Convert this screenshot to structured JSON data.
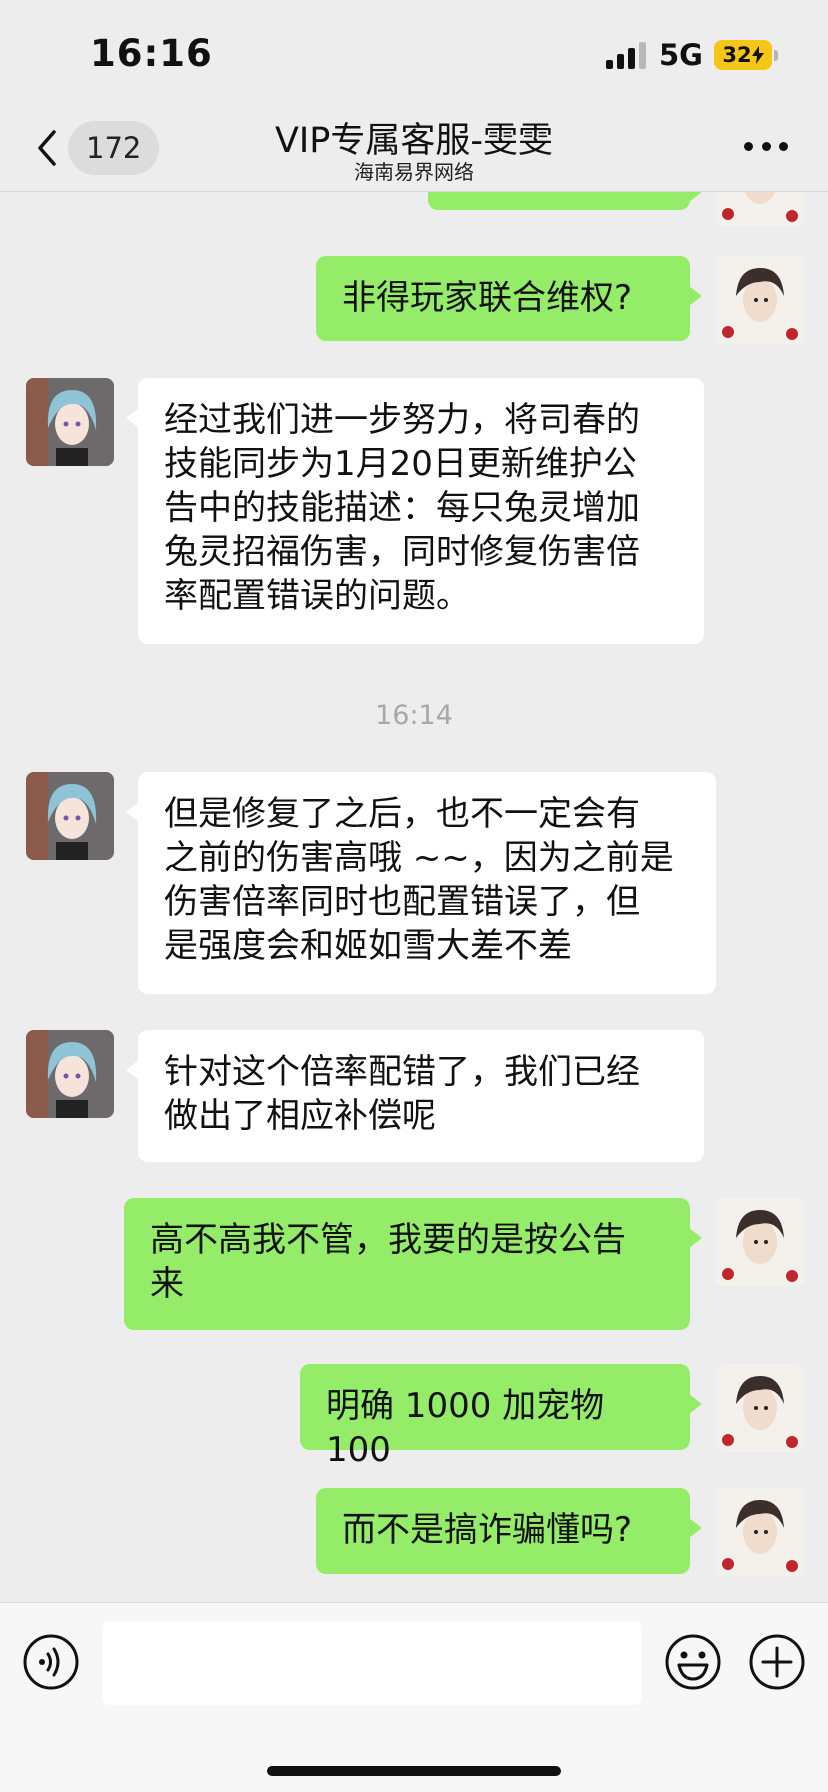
{
  "status_bar": {
    "time": "16:16",
    "network": "5G",
    "battery": "32"
  },
  "header": {
    "back_icon": "chevron-left-icon",
    "unread_count": "172",
    "title": "VIP专属客服-雯雯",
    "subtitle": "海南易界网络",
    "more_icon": "more-dots-icon"
  },
  "messages": [
    {
      "side": "out",
      "text": "非得玩家联合维权?"
    },
    {
      "side": "in",
      "lines": [
        "经过我们进一步努力，将司春的",
        "技能同步为1月20日更新维护公",
        "告中的技能描述：每只兔灵增加",
        "兔灵招福伤害，同时修复伤害倍",
        "率配置错误的问题。"
      ]
    },
    {
      "side": "time",
      "text": "16:14"
    },
    {
      "side": "in",
      "lines": [
        "但是修复了之后，也不一定会有",
        "之前的伤害高哦 ~~，因为之前是",
        "伤害倍率同时也配置错误了，但",
        "是强度会和姬如雪大差不差"
      ]
    },
    {
      "side": "in",
      "lines": [
        "针对这个倍率配错了，我们已经",
        "做出了相应补偿呢"
      ]
    },
    {
      "side": "out",
      "lines": [
        "高不高我不管，我要的是按公告",
        "来"
      ]
    },
    {
      "side": "out",
      "text": "明确 1000 加宠物 100"
    },
    {
      "side": "out",
      "text": "而不是搞诈骗懂吗?"
    }
  ],
  "input_bar": {
    "voice_icon": "voice-icon",
    "emoji_icon": "emoji-icon",
    "plus_icon": "plus-icon",
    "input_value": ""
  },
  "colors": {
    "outgoing_bubble": "#95ec69",
    "incoming_bubble": "#ffffff",
    "background": "#ededed"
  }
}
